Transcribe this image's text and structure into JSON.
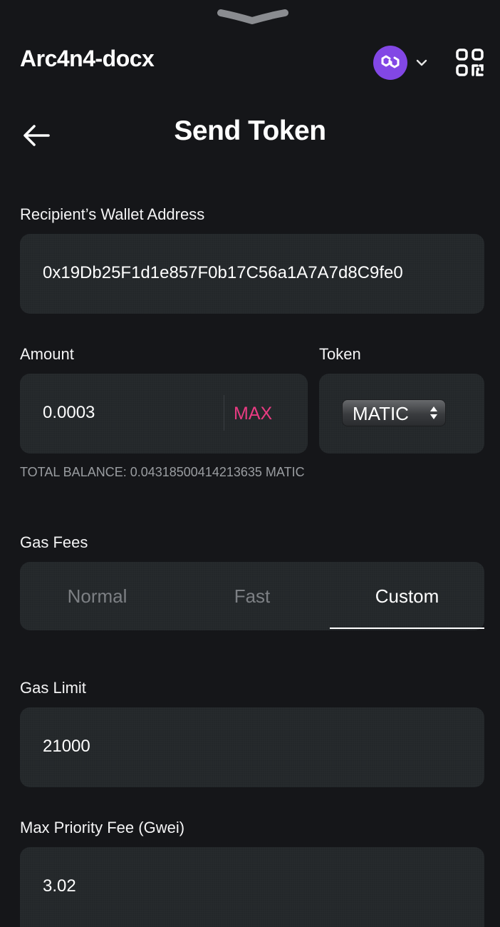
{
  "app": {
    "name": "Arc4n4-docx"
  },
  "header": {
    "network_icon": "polygon-icon",
    "network_color": "#8247e5",
    "dropdown_icon": "chevron-down-icon",
    "scan_icon": "qr-code-icon"
  },
  "page": {
    "title": "Send Token",
    "back_icon": "arrow-left-icon"
  },
  "recipient": {
    "label": "Recipient’s Wallet Address",
    "value": "0x19Db25F1d1e857F0b17C56a1A7A7d8C9fe0"
  },
  "amount": {
    "label": "Amount",
    "value": "0.0003",
    "max_label": "MAX",
    "max_color": "#e93b82"
  },
  "token": {
    "label": "Token",
    "selected": "MATIC"
  },
  "balance": {
    "text": "TOTAL BALANCE: 0.04318500414213635 MATIC"
  },
  "gas": {
    "label": "Gas Fees",
    "tabs": [
      {
        "label": "Normal",
        "active": false
      },
      {
        "label": "Fast",
        "active": false
      },
      {
        "label": "Custom",
        "active": true
      }
    ]
  },
  "gas_limit": {
    "label": "Gas Limit",
    "value": "21000"
  },
  "max_priority_fee": {
    "label": "Max Priority Fee (Gwei)",
    "value": "3.02"
  }
}
